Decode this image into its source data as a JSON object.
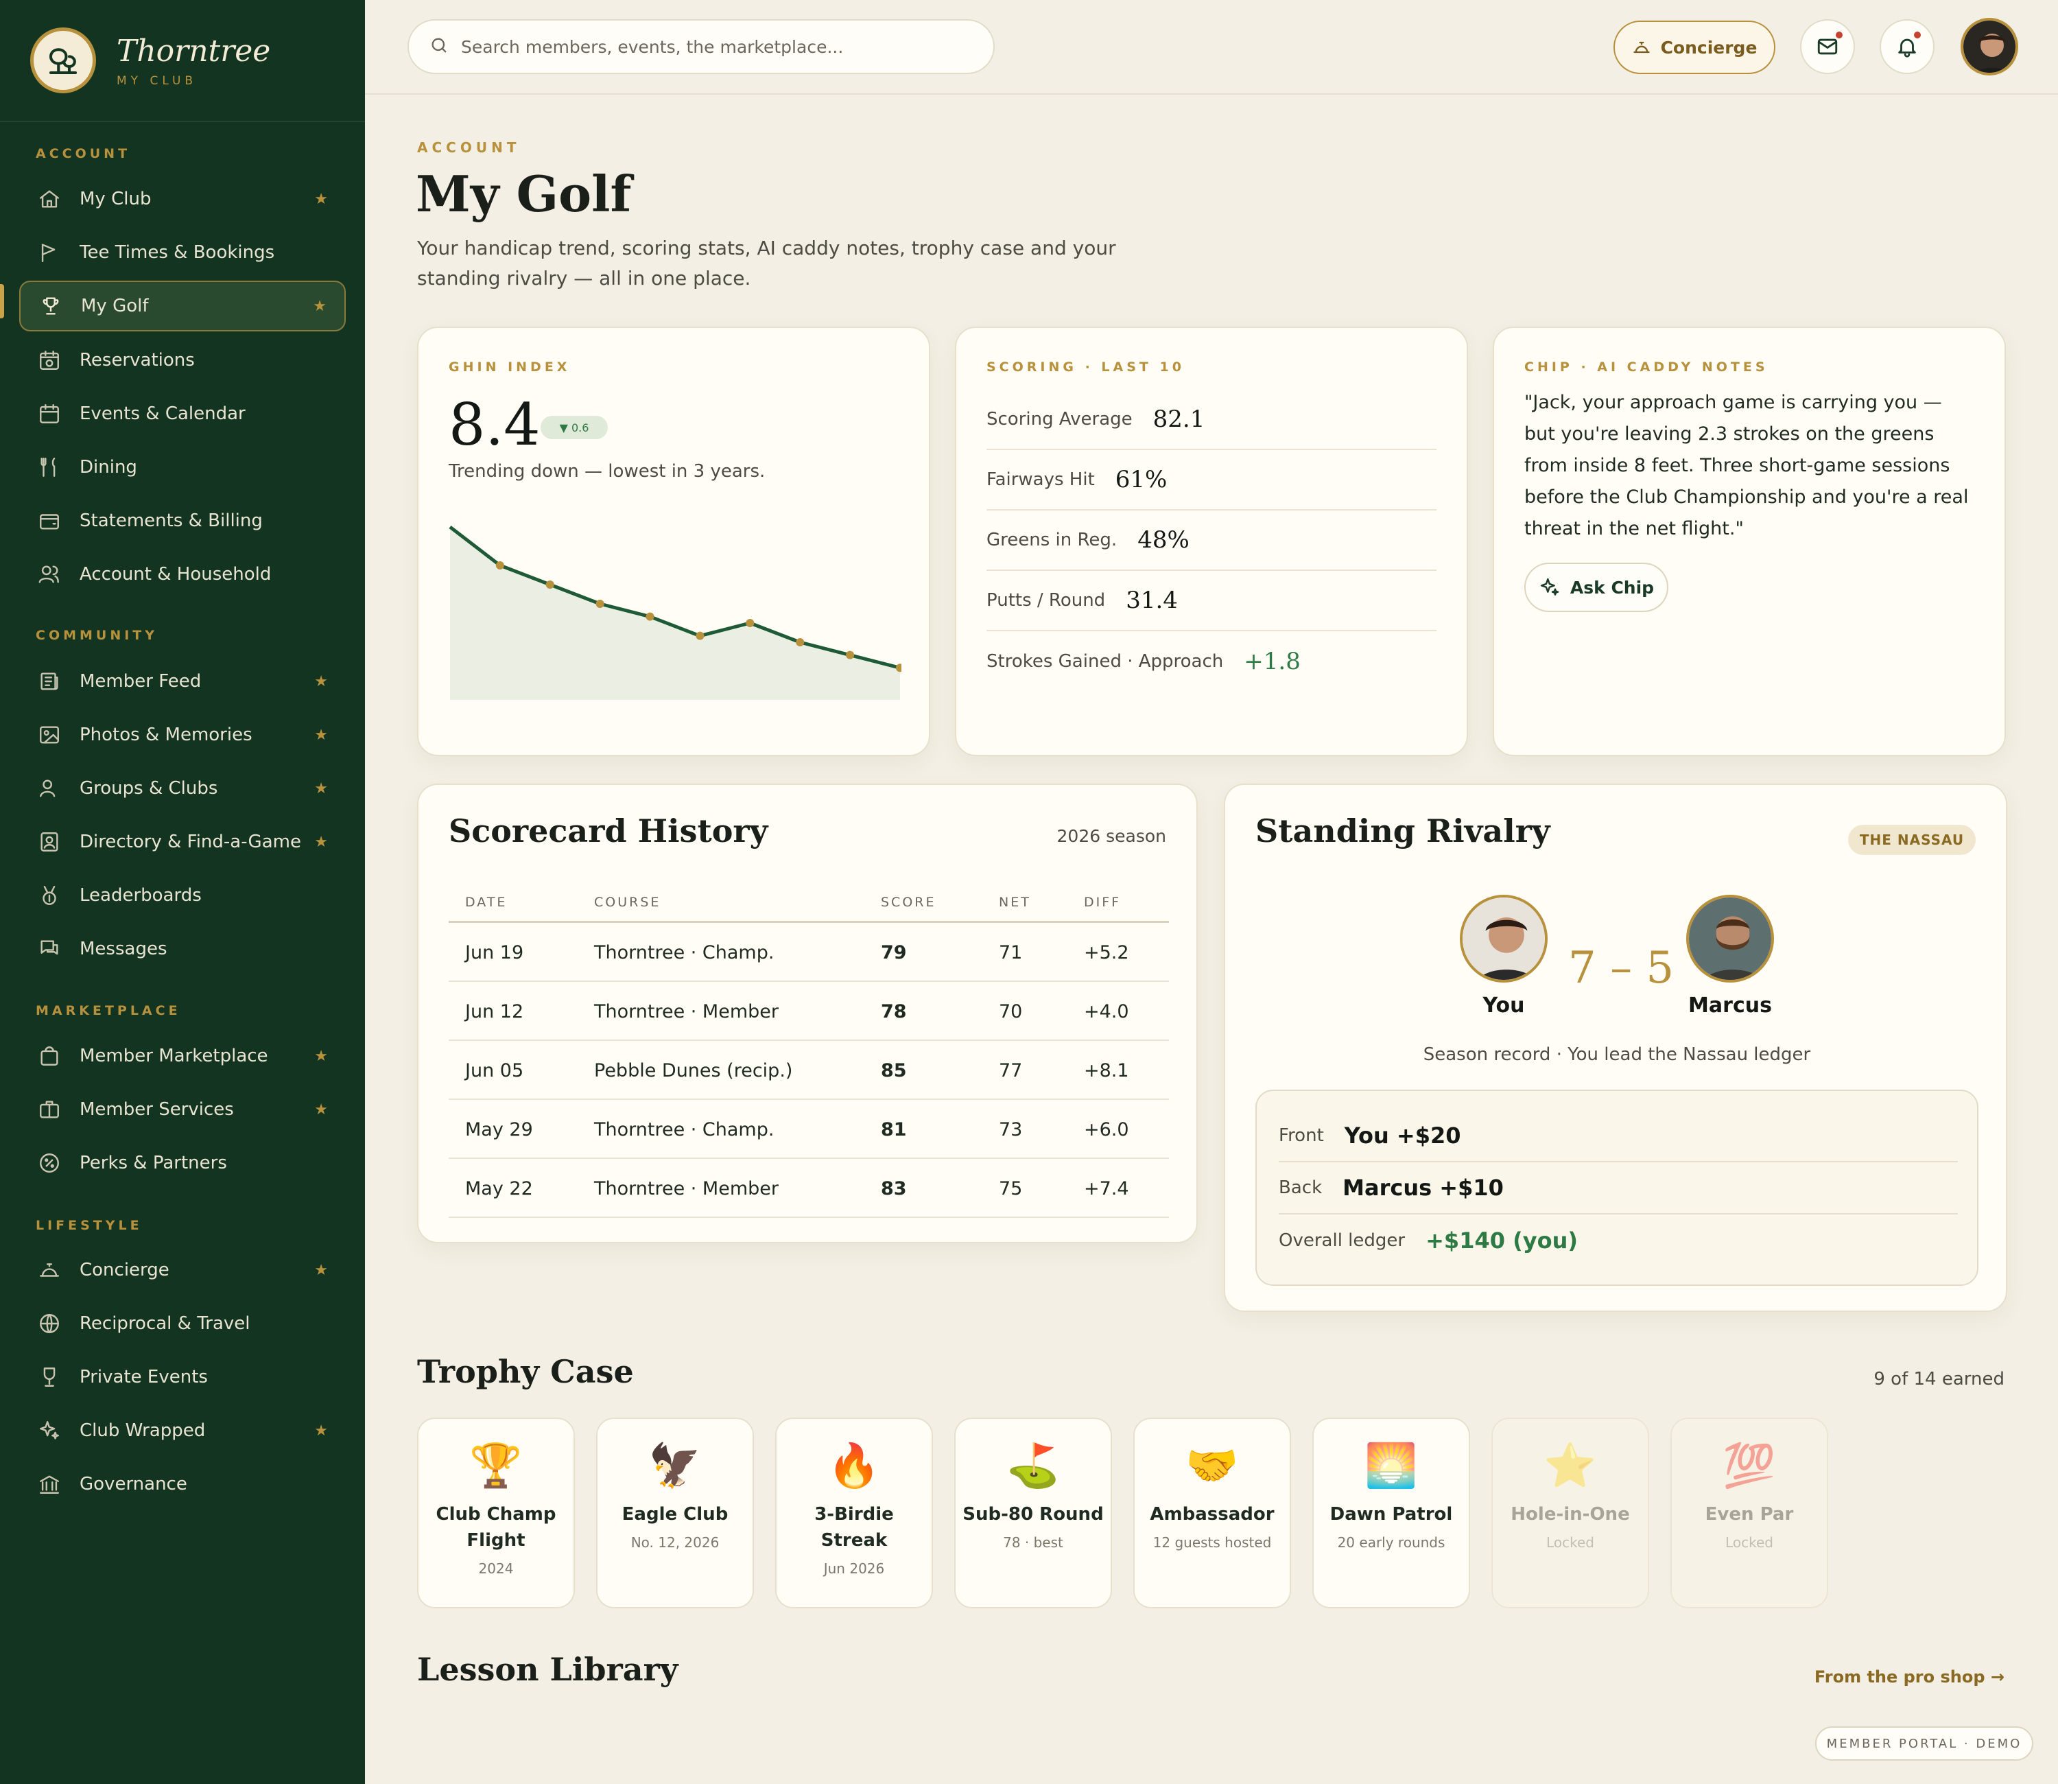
{
  "brand": {
    "name": "Thorntree",
    "subtitle": "MY CLUB"
  },
  "sidebar": {
    "sections": [
      "ACCOUNT",
      "COMMUNITY",
      "MARKETPLACE",
      "LIFESTYLE"
    ],
    "items": [
      {
        "label": "My Club",
        "icon": "home-icon",
        "starred": true
      },
      {
        "label": "Tee Times & Bookings",
        "icon": "flag-icon",
        "starred": false
      },
      {
        "label": "My Golf",
        "icon": "trophy-icon",
        "starred": true,
        "active": true
      },
      {
        "label": "Reservations",
        "icon": "calendar-clock-icon",
        "starred": false
      },
      {
        "label": "Events & Calendar",
        "icon": "calendar-icon",
        "starred": false
      },
      {
        "label": "Dining",
        "icon": "utensils-icon",
        "starred": false
      },
      {
        "label": "Statements & Billing",
        "icon": "wallet-icon",
        "starred": false
      },
      {
        "label": "Account & Household",
        "icon": "users-icon",
        "starred": false
      },
      {
        "label": "Member Feed",
        "icon": "newspaper-icon",
        "starred": true
      },
      {
        "label": "Photos & Memories",
        "icon": "image-icon",
        "starred": true
      },
      {
        "label": "Groups & Clubs",
        "icon": "group-icon",
        "starred": true
      },
      {
        "label": "Directory & Find-a-Game",
        "icon": "contact-icon",
        "starred": true
      },
      {
        "label": "Leaderboards",
        "icon": "medal-icon",
        "starred": false
      },
      {
        "label": "Messages",
        "icon": "chat-icon",
        "starred": false
      },
      {
        "label": "Member Marketplace",
        "icon": "shopping-bag-icon",
        "starred": true
      },
      {
        "label": "Member Services",
        "icon": "briefcase-icon",
        "starred": true
      },
      {
        "label": "Perks & Partners",
        "icon": "badge-percent-icon",
        "starred": false
      },
      {
        "label": "Concierge",
        "icon": "bell-service-icon",
        "starred": true
      },
      {
        "label": "Reciprocal & Travel",
        "icon": "globe-icon",
        "starred": false
      },
      {
        "label": "Private Events",
        "icon": "glass-icon",
        "starred": false
      },
      {
        "label": "Club Wrapped",
        "icon": "sparkles-icon",
        "starred": true
      },
      {
        "label": "Governance",
        "icon": "landmark-icon",
        "starred": false
      }
    ],
    "star_glyph": "★"
  },
  "topbar": {
    "search_placeholder": "Search members, events, the marketplace...",
    "concierge_label": "Concierge"
  },
  "page": {
    "eyebrow": "ACCOUNT",
    "title": "My Golf",
    "subtitle": "Your handicap trend, scoring stats, AI caddy notes, trophy case and your standing rivalry — all in one place."
  },
  "ghin": {
    "label": "GHIN INDEX",
    "value": "8.4",
    "change": "▼ 0.6",
    "trend_text": "Trending down — lowest in 3 years."
  },
  "chart_data": {
    "type": "area",
    "values": [
      10.2,
      9.6,
      9.3,
      9.0,
      8.8,
      8.5,
      8.7,
      8.4,
      8.2,
      8.0
    ],
    "ylim": [
      7.5,
      10.5
    ],
    "grid": false
  },
  "scoring": {
    "label": "SCORING · LAST 10",
    "stats": [
      {
        "label": "Scoring Average",
        "value": "82.1"
      },
      {
        "label": "Fairways Hit",
        "value": "61%"
      },
      {
        "label": "Greens in Reg.",
        "value": "48%"
      },
      {
        "label": "Putts / Round",
        "value": "31.4"
      },
      {
        "label": "Strokes Gained · Approach",
        "value": "+1.8"
      }
    ]
  },
  "chip": {
    "label": "CHIP · AI CADDY NOTES",
    "quote": "\"Jack, your approach game is carrying you — but you're leaving 2.3 strokes on the greens from inside 8 feet. Three short-game sessions before the Club Championship and you're a real threat in the net flight.\"",
    "button": "Ask Chip"
  },
  "scorecard": {
    "title": "Scorecard History",
    "season": "2026 season",
    "headers": [
      "DATE",
      "COURSE",
      "SCORE",
      "NET",
      "DIFF"
    ],
    "rows": [
      [
        "Jun 19",
        "Thorntree · Champ.",
        "79",
        "71",
        "+5.2"
      ],
      [
        "Jun 12",
        "Thorntree · Member",
        "78",
        "70",
        "+4.0"
      ],
      [
        "Jun 05",
        "Pebble Dunes (recip.)",
        "85",
        "77",
        "+8.1"
      ],
      [
        "May 29",
        "Thorntree · Champ.",
        "81",
        "73",
        "+6.0"
      ],
      [
        "May 22",
        "Thorntree · Member",
        "83",
        "75",
        "+7.4"
      ]
    ]
  },
  "rivalry": {
    "title": "Standing Rivalry",
    "badge": "THE NASSAU",
    "player_a": "You",
    "player_b": "Marcus",
    "score": "7 – 5",
    "record": "Season record · You lead the Nassau ledger",
    "ledger": [
      {
        "label": "Front",
        "value": "You +$20"
      },
      {
        "label": "Back",
        "value": "Marcus +$10"
      },
      {
        "label": "Overall ledger",
        "value": "+$140 (you)"
      }
    ]
  },
  "trophies": {
    "title": "Trophy Case",
    "count": "9 of 14 earned",
    "items": [
      {
        "name": "Club Champ Flight",
        "sub": "2024",
        "glyph": "🏆",
        "locked": false
      },
      {
        "name": "Eagle Club",
        "sub": "No. 12, 2026",
        "glyph": "🦅",
        "locked": false
      },
      {
        "name": "3-Birdie Streak",
        "sub": "Jun 2026",
        "glyph": "🔥",
        "locked": false
      },
      {
        "name": "Sub-80 Round",
        "sub": "78 · best",
        "glyph": "⛳",
        "locked": false
      },
      {
        "name": "Ambassador",
        "sub": "12 guests hosted",
        "glyph": "🤝",
        "locked": false
      },
      {
        "name": "Dawn Patrol",
        "sub": "20 early rounds",
        "glyph": "🌅",
        "locked": false
      },
      {
        "name": "Hole-in-One",
        "sub": "Locked",
        "glyph": "⭐",
        "locked": true
      },
      {
        "name": "Even Par",
        "sub": "Locked",
        "glyph": "💯",
        "locked": true
      }
    ]
  },
  "lessons": {
    "title": "Lesson Library",
    "link": "From the pro shop →"
  },
  "footer": {
    "demo": "MEMBER PORTAL · DEMO"
  },
  "colors": {
    "sidebar": "#123421",
    "accent": "#b8913c",
    "positive": "#2e7a44",
    "background": "#f3efe4"
  }
}
